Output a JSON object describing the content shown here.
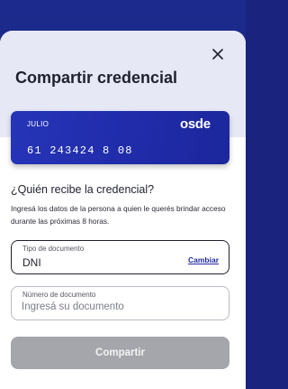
{
  "sheet": {
    "title": "Compartir credencial",
    "close_icon": "close-icon"
  },
  "card": {
    "month": "JULIO",
    "brand": "osde",
    "number": "61 243424 8 08",
    "color": "#2634b8"
  },
  "recipient": {
    "question": "¿Quién recibe la credencial?",
    "description": "Ingresá los datos de la persona a quien le querés brindar acceso durante las próximas 8 horas."
  },
  "document_type": {
    "label": "Tipo de documento",
    "value": "DNI",
    "change_label": "Cambiar"
  },
  "document_number": {
    "label": "Número de documento",
    "placeholder": "Ingresá su documento",
    "value": ""
  },
  "actions": {
    "share_label": "Compartir",
    "share_enabled": false
  }
}
